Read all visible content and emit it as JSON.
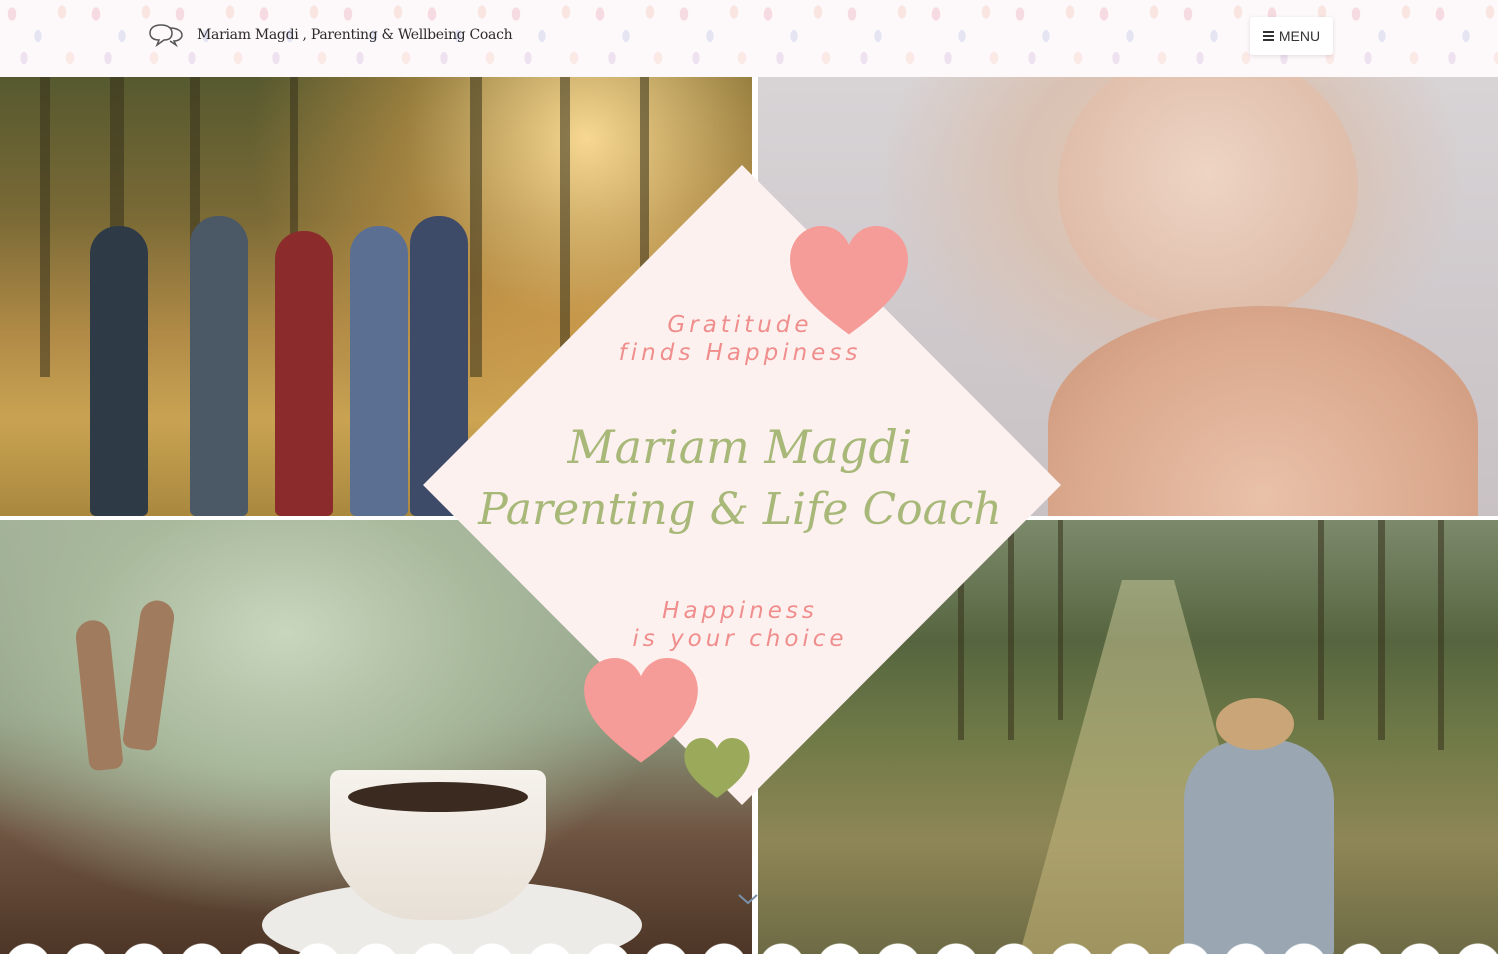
{
  "header": {
    "site_title": "Mariam Magdi , Parenting &  Wellbeing Coach",
    "menu_label": "MENU",
    "logo_icon": "speech-bubbles-icon",
    "menu_icon": "hamburger-icon"
  },
  "hero": {
    "tagline_top_line1": "Gratitude",
    "tagline_top_line2": "finds Happiness",
    "name_script": "Mariam Magdi",
    "role_script": "Parenting & Life Coach",
    "tagline_bottom_line1": "Happiness",
    "tagline_bottom_line2": "is your choice",
    "scroll_icon": "chevron-down-icon",
    "photos": [
      "family-walking-photo",
      "baby-feet-photo",
      "coffee-cup-photo",
      "forest-walker-photo"
    ]
  },
  "colors": {
    "diamond_bg": "#fdf1f0",
    "tagline_pink": "#ef8e8c",
    "script_green": "#a7b878",
    "heart_pink": "#f59c98",
    "heart_green": "#9aaa5a"
  }
}
